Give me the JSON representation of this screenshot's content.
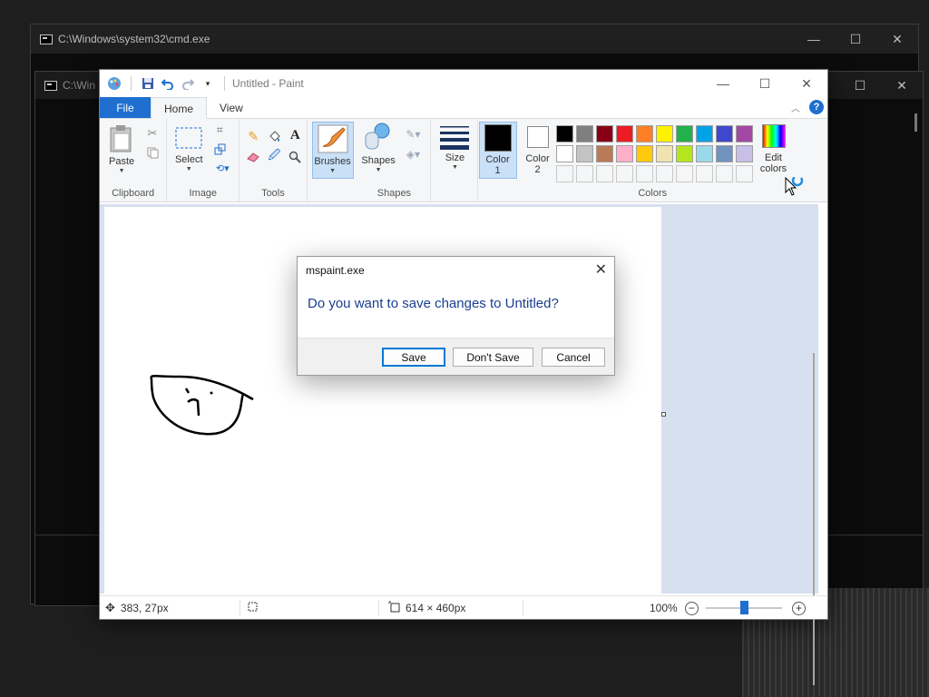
{
  "cmd_back": {
    "title": "C:\\Windows\\system32\\cmd.exe"
  },
  "cmd_front": {
    "title": "C:\\Win"
  },
  "paint": {
    "title": "Untitled - Paint",
    "tabs": {
      "file": "File",
      "home": "Home",
      "view": "View"
    },
    "ribbon": {
      "clipboard": {
        "paste": "Paste",
        "group": "Clipboard"
      },
      "image": {
        "select": "Select",
        "group": "Image"
      },
      "tools": {
        "group": "Tools"
      },
      "brushes": {
        "label": "Brushes"
      },
      "shapes": {
        "label": "Shapes",
        "group": "Shapes"
      },
      "size": {
        "label": "Size"
      },
      "color1": {
        "label_line1": "Color",
        "label_line2": "1",
        "value": "#000000"
      },
      "color2": {
        "label_line1": "Color",
        "label_line2": "2",
        "value": "#ffffff"
      },
      "edit_colors": {
        "label_line1": "Edit",
        "label_line2": "colors"
      },
      "colors_group": "Colors",
      "palette": [
        "#000000",
        "#7f7f7f",
        "#880015",
        "#ed1c24",
        "#ff7f27",
        "#fff200",
        "#22b14c",
        "#00a2e8",
        "#3f48cc",
        "#a349a4",
        "#ffffff",
        "#c3c3c3",
        "#b97a57",
        "#ffaec9",
        "#ffc90e",
        "#efe4b0",
        "#b5e61d",
        "#99d9ea",
        "#7092be",
        "#c8bfe7"
      ]
    },
    "status": {
      "cursor": "383, 27px",
      "image_size": "614 × 460px",
      "zoom": "100%"
    }
  },
  "dialog": {
    "title": "mspaint.exe",
    "message": "Do you want to save changes to Untitled?",
    "save": "Save",
    "dont_save": "Don't Save",
    "cancel": "Cancel"
  }
}
